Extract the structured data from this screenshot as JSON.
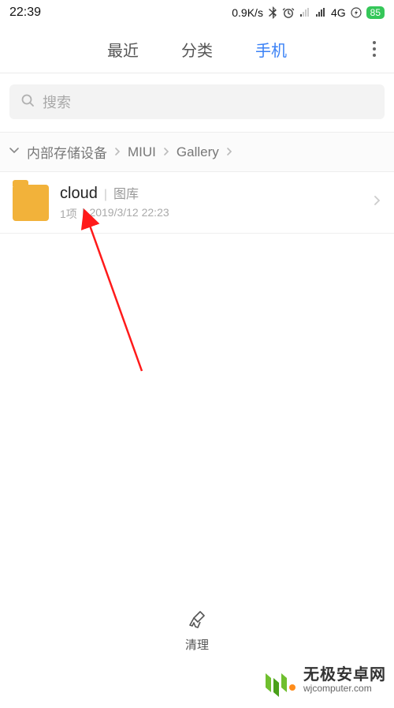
{
  "status": {
    "time": "22:39",
    "speed": "0.9K/s",
    "network": "4G",
    "battery": "85"
  },
  "tabs": {
    "recent": "最近",
    "category": "分类",
    "phone": "手机",
    "active": "phone"
  },
  "search": {
    "placeholder": "搜索"
  },
  "breadcrumb": {
    "root": "内部存储设备",
    "seg1": "MIUI",
    "seg2": "Gallery"
  },
  "items": [
    {
      "name": "cloud",
      "tag": "图库",
      "count": "1项",
      "date": "2019/3/12 22:23"
    }
  ],
  "bottom": {
    "clean": "清理"
  },
  "watermark": {
    "name": "无极安卓网",
    "url": "wjcomputer.com"
  }
}
